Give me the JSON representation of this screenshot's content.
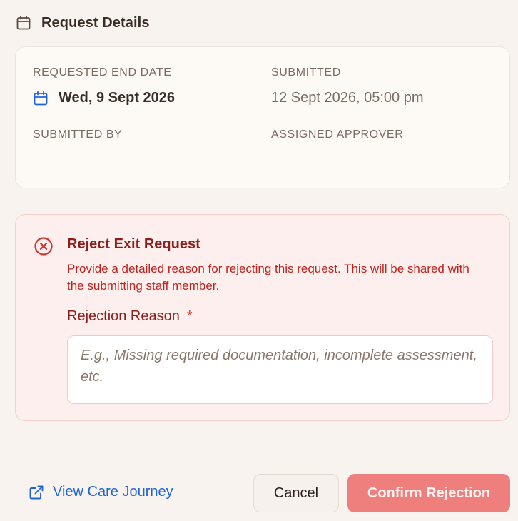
{
  "section": {
    "title": "Request Details",
    "icon": "calendar-icon"
  },
  "details": {
    "requested_end_date": {
      "label": "REQUESTED END DATE",
      "value": "Wed, 9 Sept 2026",
      "icon": "calendar-icon"
    },
    "submitted": {
      "label": "SUBMITTED",
      "value": "12 Sept 2026, 05:00 pm"
    },
    "submitted_by": {
      "label": "SUBMITTED BY",
      "value": ""
    },
    "assigned_approver": {
      "label": "ASSIGNED APPROVER",
      "value": ""
    }
  },
  "reject": {
    "icon": "x-circle-icon",
    "title": "Reject Exit Request",
    "description": "Provide a detailed reason for rejecting this request. This will be shared with the submitting staff member.",
    "reason_label": "Rejection Reason",
    "required_marker": "*",
    "reason_value": "",
    "reason_placeholder": "E.g., Missing required documentation, incomplete assessment, etc."
  },
  "footer": {
    "view_care_journey": "View Care Journey",
    "cancel": "Cancel",
    "confirm": "Confirm Rejection"
  },
  "colors": {
    "background": "#f8f3ee",
    "danger_text": "#c0221d",
    "danger_title": "#8e1d1b",
    "danger_bg": "#fcefed",
    "link": "#1f63d8",
    "confirm_button": "#ef7f7c"
  }
}
